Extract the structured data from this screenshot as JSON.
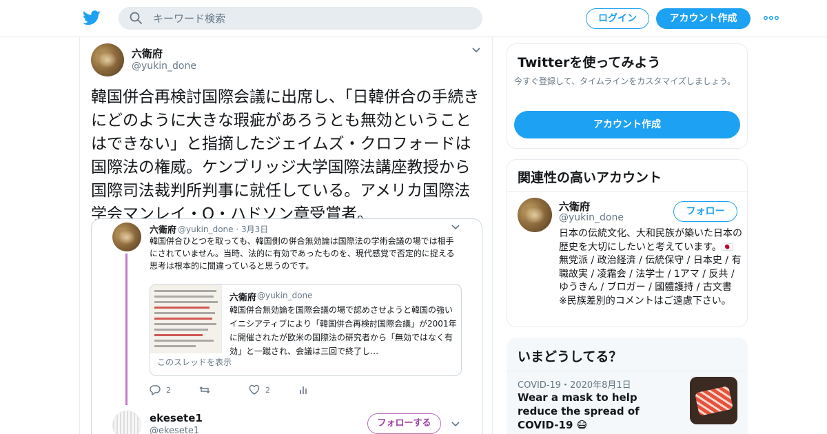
{
  "header": {
    "search_placeholder": "キーワード検索",
    "login_label": "ログイン",
    "signup_label": "アカウント作成",
    "brand_color": "#1da1f2"
  },
  "tweet": {
    "author_name": "六衛府",
    "author_handle": "@yukin_done",
    "text": "韓国併合再検討国際会議に出席し、「日韓併合の手続きにどのように大きな瑕疵があろうとも無効ということはできない」と指摘したジェイムズ・クロフォードは国際法の権威。ケンブリッジ大学国際法講座教授から国際司法裁判所判事に就任している。アメリカ国際法学会マンレイ・O・ハドソン章受賞者。",
    "quoted": {
      "author_name": "六衛府",
      "author_handle": "@yukin_done · 3月3日",
      "text": "韓国併合ひとつを取っても、韓国側の併合無効論は国際法の学術会議の場では相手にされていません。当時、法的に有効であったものを、現代感覚で否定的に捉える思考は根本的に間違っていると思うのです。",
      "inner": {
        "author_name": "六衛府",
        "author_handle": "@yukin_done",
        "text": "韓国併合無効論を国際会議の場で認めさせようと韓国の強いイニシアティブにより「韓国併合再検討国際会議」が2001年に開催されたが欧米の国際法の研究者から「無効ではなく有効」と一蹴され、会議は三回で終了し…",
        "show_thread": "このスレッドを表示"
      },
      "actions": {
        "replies": "2",
        "likes": "2"
      },
      "reply": {
        "author_name": "ekesete1",
        "author_handle": "@ekesete1",
        "follow_label": "フォローする"
      }
    }
  },
  "sidebar": {
    "try": {
      "title": "Twitterを使ってみよう",
      "subtitle": "今すぐ登録して、タイムラインをカスタマイズしましょう。",
      "button": "アカウント作成"
    },
    "related": {
      "title": "関連性の高いアカウント",
      "name": "六衛府",
      "handle": "@yukin_done",
      "follow_label": "フォロー",
      "bio": "日本の伝統文化、大和民族が築いた日本の歴史を大切にしたいと考えています。🇯🇵 無党派 / 政治経済 / 伝統保守 / 日本史 / 有職故実 / 凌霜会 / 法学士 / 1アマ / 反共 / ゆうきん / ブロガー / 國體護持 / 古文書 ※民族差別的コメントはご遠慮下さい。"
    },
    "trends": {
      "title": "いまどうしてる？",
      "meta": "COVID-19・2020年8月1日",
      "headline": "Wear a mask to help reduce the spread of COVID-19 😷"
    }
  }
}
